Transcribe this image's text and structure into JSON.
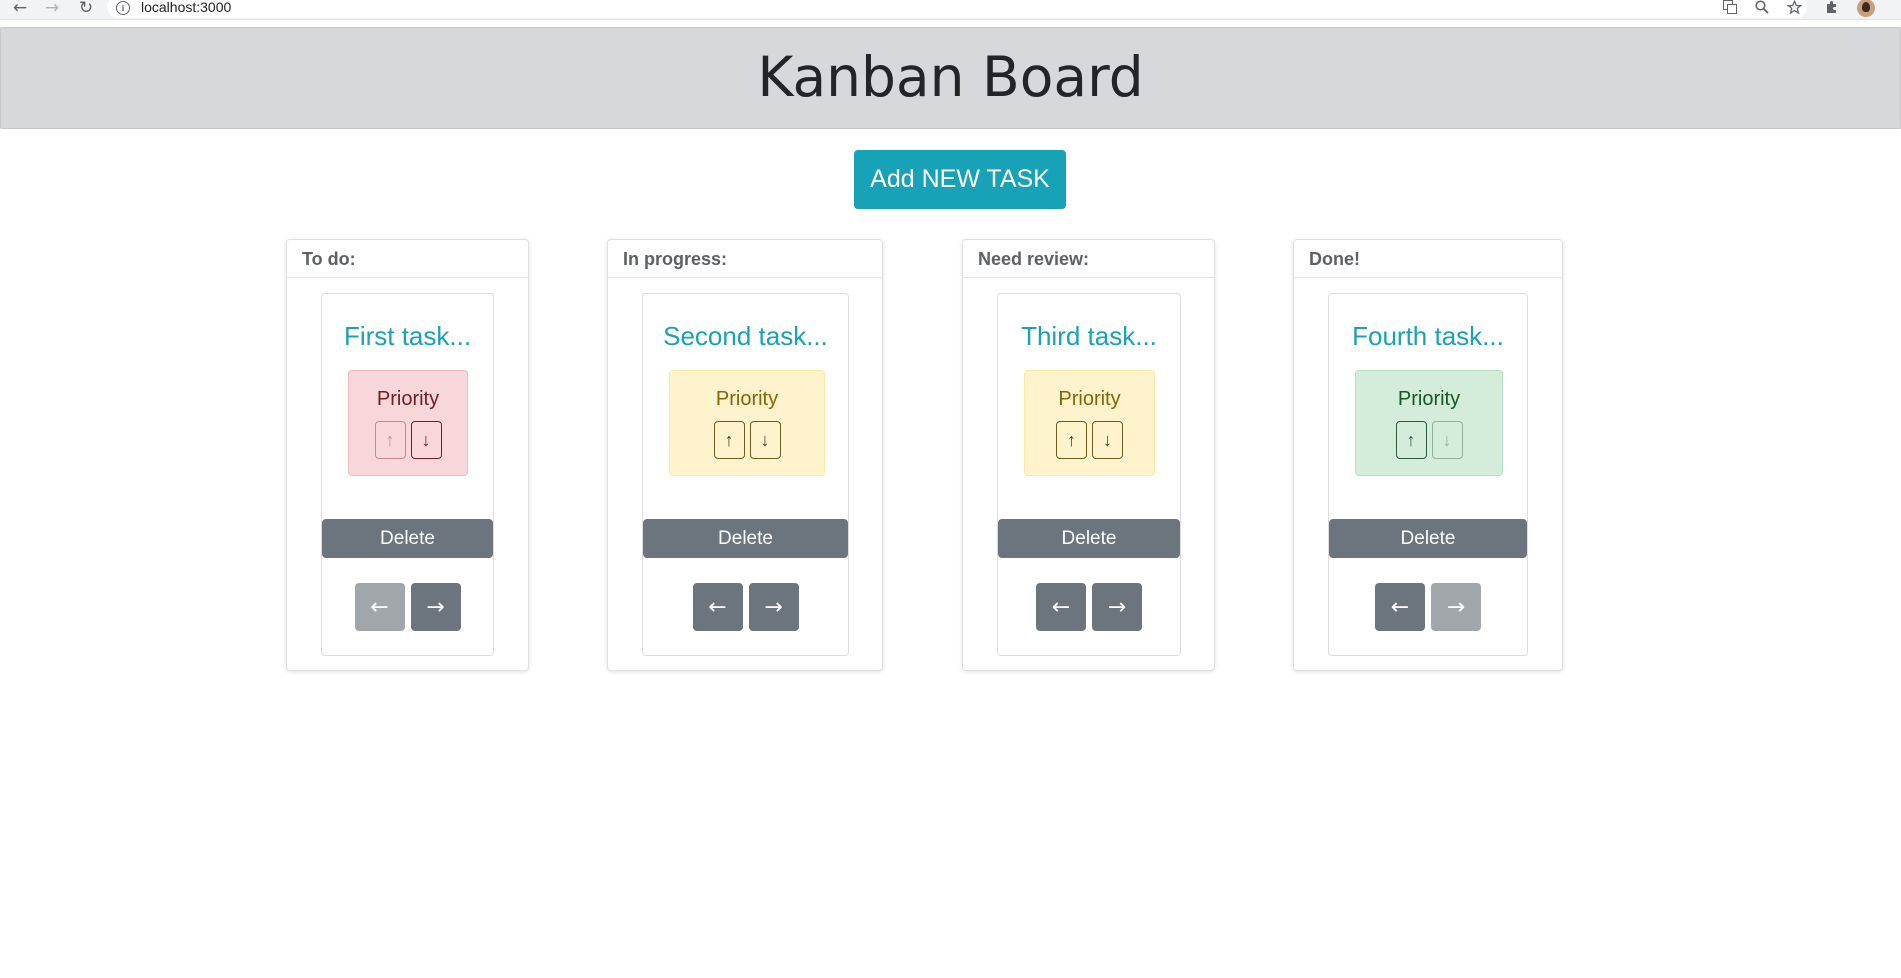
{
  "browser": {
    "back_icon": "←",
    "forward_icon": "→",
    "reload_icon": "↻",
    "info_icon": "i",
    "url": "localhost:3000"
  },
  "header": {
    "title": "Kanban Board"
  },
  "actions": {
    "add_label": "Add NEW TASK"
  },
  "columns": [
    {
      "title": "To do:",
      "task": {
        "title": "First task...",
        "priority_label": "Priority",
        "priority_level": "high",
        "up": "↑",
        "down": "↓",
        "delete": "Delete",
        "left": "←",
        "right": "→"
      }
    },
    {
      "title": "In progress:",
      "task": {
        "title": "Second task...",
        "priority_label": "Priority",
        "priority_level": "medium",
        "up": "↑",
        "down": "↓",
        "delete": "Delete",
        "left": "←",
        "right": "→"
      }
    },
    {
      "title": "Need review:",
      "task": {
        "title": "Third task...",
        "priority_label": "Priority",
        "priority_level": "medium",
        "up": "↑",
        "down": "↓",
        "delete": "Delete",
        "left": "←",
        "right": "→"
      }
    },
    {
      "title": "Done!",
      "task": {
        "title": "Fourth task...",
        "priority_label": "Priority",
        "priority_level": "low",
        "up": "↑",
        "down": "↓",
        "delete": "Delete",
        "left": "←",
        "right": "→"
      }
    }
  ],
  "colors": {
    "accent": "#17a2b8",
    "secondary": "#6c757d",
    "header_bg": "#d6d8db",
    "priority_high": "#f8d7da",
    "priority_medium": "#fff3cd",
    "priority_low": "#d4edda"
  }
}
